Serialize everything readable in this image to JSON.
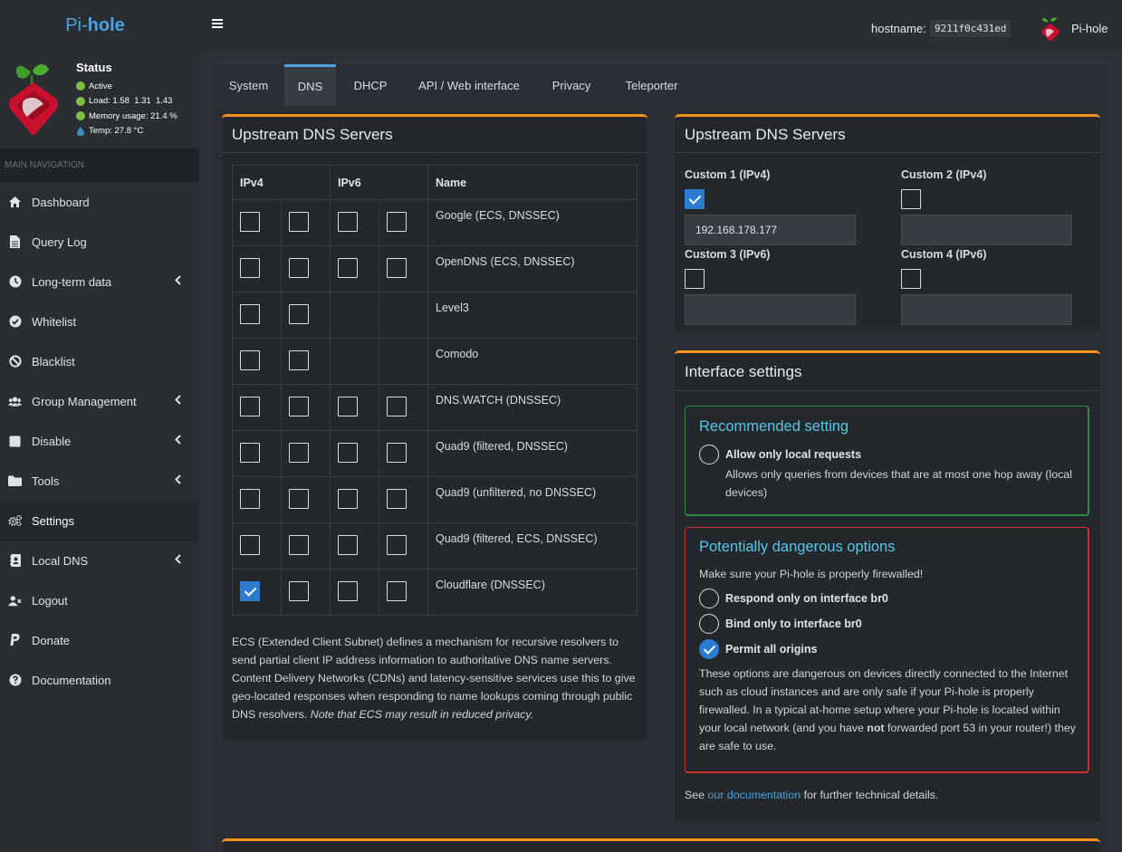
{
  "app": {
    "brand_pre": "Pi-",
    "brand_bold": "hole"
  },
  "status": {
    "title": "Status",
    "active": "Active",
    "load_label": "Load:",
    "load": "1.58  1.31  1.43",
    "memory_label": "Memory usage:",
    "memory": "21.4 %",
    "temp": "Temp: 27.8 °C",
    "colors": {
      "ok": "#7bc043",
      "temp": "#3c8dbc"
    }
  },
  "topbar": {
    "hostname_label": "hostname:",
    "hostname": "9211f0c431ed",
    "name": "Pi-hole"
  },
  "nav": {
    "header": "MAIN NAVIGATION",
    "items": [
      {
        "label": "Dashboard",
        "icon": "home-icon"
      },
      {
        "label": "Query Log",
        "icon": "file-icon"
      },
      {
        "label": "Long-term data",
        "icon": "clock-icon"
      },
      {
        "label": "Whitelist",
        "icon": "check-circle-icon"
      },
      {
        "label": "Blacklist",
        "icon": "ban-icon"
      },
      {
        "label": "Group Management",
        "icon": "users-icon"
      },
      {
        "label": "Disable",
        "icon": "stop-icon"
      },
      {
        "label": "Tools",
        "icon": "folder-icon"
      },
      {
        "label": "Settings",
        "icon": "gears-icon"
      },
      {
        "label": "Local DNS",
        "icon": "address-book-icon"
      },
      {
        "label": "Logout",
        "icon": "user-times-icon"
      },
      {
        "label": "Donate",
        "icon": "paypal-icon"
      },
      {
        "label": "Documentation",
        "icon": "question-circle-icon"
      }
    ]
  },
  "tabs": [
    "System",
    "DNS",
    "DHCP",
    "API / Web interface",
    "Privacy",
    "Teleporter"
  ],
  "upstream": {
    "title": "Upstream DNS Servers",
    "col_ipv4": "IPv4",
    "col_ipv6": "IPv6",
    "col_name": "Name",
    "rows": [
      {
        "name": "Google (ECS, DNSSEC)",
        "checks": [
          false,
          false,
          false,
          false
        ]
      },
      {
        "name": "OpenDNS (ECS, DNSSEC)",
        "checks": [
          false,
          false,
          false,
          false
        ]
      },
      {
        "name": "Level3",
        "checks": [
          false,
          false,
          null,
          null
        ]
      },
      {
        "name": "Comodo",
        "checks": [
          false,
          false,
          null,
          null
        ]
      },
      {
        "name": "DNS.WATCH (DNSSEC)",
        "checks": [
          false,
          false,
          false,
          false
        ]
      },
      {
        "name": "Quad9 (filtered, DNSSEC)",
        "checks": [
          false,
          false,
          false,
          false
        ]
      },
      {
        "name": "Quad9 (unfiltered, no DNSSEC)",
        "checks": [
          false,
          false,
          false,
          false
        ]
      },
      {
        "name": "Quad9 (filtered, ECS, DNSSEC)",
        "checks": [
          false,
          false,
          false,
          false
        ]
      },
      {
        "name": "Cloudflare (DNSSEC)",
        "checks": [
          true,
          false,
          false,
          false
        ]
      }
    ],
    "ecs_text": "ECS (Extended Client Subnet) defines a mechanism for recursive resolvers to send partial client IP address information to authoritative DNS name servers. Content Delivery Networks (CDNs) and latency-sensitive services use this to give geo-located responses when responding to name lookups coming through public DNS resolvers. ",
    "ecs_note": "Note that ECS may result in reduced privacy."
  },
  "custom": {
    "title": "Upstream DNS Servers",
    "c1": {
      "label": "Custom 1 (IPv4)",
      "checked": true,
      "value": "192.168.178.177"
    },
    "c2": {
      "label": "Custom 2 (IPv4)",
      "checked": false,
      "value": ""
    },
    "c3": {
      "label": "Custom 3 (IPv6)",
      "checked": false,
      "value": ""
    },
    "c4": {
      "label": "Custom 4 (IPv6)",
      "checked": false,
      "value": ""
    }
  },
  "iface": {
    "title": "Interface settings",
    "rec_title": "Recommended setting",
    "local_label": "Allow only local requests",
    "local_desc": "Allows only queries from devices that are at most one hop away (local devices)",
    "danger_title": "Potentially dangerous options",
    "danger_intro": "Make sure your Pi-hole is properly firewalled!",
    "opt_br0": "Respond only on interface br0",
    "opt_bind": "Bind only to interface br0",
    "opt_all": "Permit all origins",
    "selected": "opt_all",
    "danger_text_1": "These options are dangerous on devices directly connected to the Internet such as cloud instances and are only safe if your Pi-hole is properly firewalled. In a typical at-home setup where your Pi-hole is located within your local network (and you have ",
    "danger_bold": "not",
    "danger_text_2": " forwarded port 53 in your router!) they are safe to use.",
    "see_pre": "See ",
    "see_link": "our documentation",
    "see_post": " for further technical details."
  }
}
